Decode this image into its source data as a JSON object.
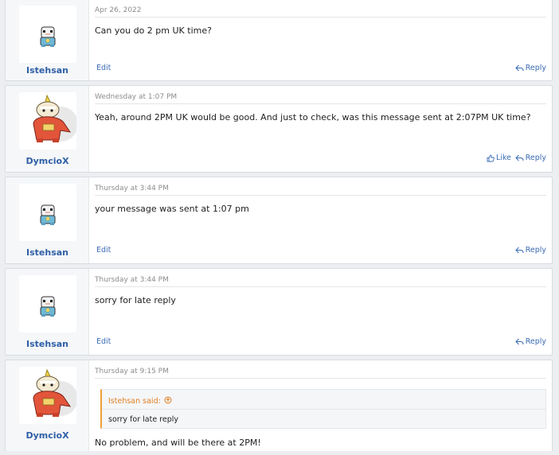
{
  "posts": [
    {
      "username": "Istehsan",
      "avatar": "oshawott-sprite",
      "date": "Apr 26, 2022",
      "text": "Can you do 2 pm UK time?",
      "actions": {
        "edit": "Edit",
        "reply": "Reply"
      }
    },
    {
      "username": "DymcioX",
      "avatar": "fuecoco-sprite",
      "date": "Wednesday at 1:07 PM",
      "text": "Yeah, around 2PM UK would be good. And just to check, was this message sent at 2:07PM UK time?",
      "actions": {
        "like": "Like",
        "reply": "Reply"
      }
    },
    {
      "username": "Istehsan",
      "avatar": "oshawott-sprite",
      "date": "Thursday at 3:44 PM",
      "text": "your message was sent at 1:07 pm",
      "actions": {
        "edit": "Edit",
        "reply": "Reply"
      }
    },
    {
      "username": "Istehsan",
      "avatar": "oshawott-sprite",
      "date": "Thursday at 3:44 PM",
      "text": "sorry for late reply",
      "actions": {
        "edit": "Edit",
        "reply": "Reply"
      }
    },
    {
      "username": "DymcioX",
      "avatar": "fuecoco-sprite",
      "date": "Thursday at 9:15 PM",
      "quote": {
        "author": "Istehsan said:",
        "text": "sorry for late reply"
      },
      "text": "No problem, and will be there at 2PM!"
    }
  ],
  "colors": {
    "link": "#3a6bb5",
    "username": "#2f5fa5",
    "quote_accent": "#e07f20"
  },
  "icons": {
    "reply": "reply-arrow-icon",
    "like": "thumbs-up-icon",
    "quote_jump": "circle-arrow-up-icon"
  }
}
